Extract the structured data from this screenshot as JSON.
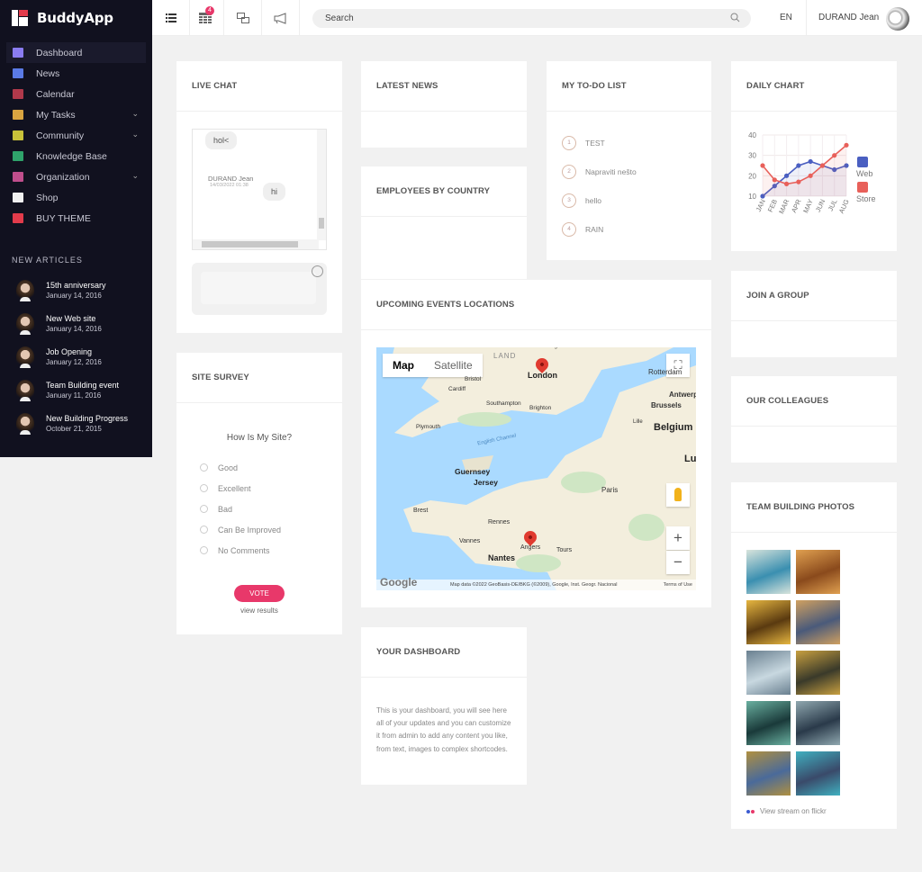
{
  "brand": {
    "name": "BuddyApp"
  },
  "topbar": {
    "icons": [
      {
        "name": "menu-list-icon"
      },
      {
        "name": "calendar-grid-icon",
        "badge": "4"
      },
      {
        "name": "chat-bubbles-icon"
      },
      {
        "name": "megaphone-icon"
      }
    ],
    "search_placeholder": "Search",
    "language": "EN",
    "user_name": "DURAND Jean"
  },
  "sidebar": {
    "items": [
      {
        "label": "Dashboard",
        "icon": "sliders-icon",
        "color": "#8a7cf0",
        "active": true,
        "has_submenu": false
      },
      {
        "label": "News",
        "icon": "document-icon",
        "color": "#5b7be6",
        "active": false,
        "has_submenu": false
      },
      {
        "label": "Calendar",
        "icon": "calendar-icon",
        "color": "#b0394b",
        "active": false,
        "has_submenu": false
      },
      {
        "label": "My Tasks",
        "icon": "tasks-icon",
        "color": "#d9a441",
        "active": false,
        "has_submenu": true
      },
      {
        "label": "Community",
        "icon": "community-icon",
        "color": "#c9c23a",
        "active": false,
        "has_submenu": true
      },
      {
        "label": "Knowledge Base",
        "icon": "lifebuoy-icon",
        "color": "#2fa36b",
        "active": false,
        "has_submenu": false
      },
      {
        "label": "Organization",
        "icon": "grid-icon",
        "color": "#c04e8c",
        "active": false,
        "has_submenu": true
      },
      {
        "label": "Shop",
        "icon": "shopping-bag-icon",
        "color": "#f0f0f0",
        "active": false,
        "has_submenu": false
      },
      {
        "label": "BUY THEME",
        "icon": "cart-icon",
        "color": "#e23b4b",
        "active": false,
        "has_submenu": false
      }
    ],
    "articles_heading": "NEW ARTICLES",
    "articles": [
      {
        "title": "15th anniversary",
        "date": "January 14, 2016"
      },
      {
        "title": "New Web site",
        "date": "January 14, 2016"
      },
      {
        "title": "Job Opening",
        "date": "January 12, 2016"
      },
      {
        "title": "Team Building event",
        "date": "January 11, 2016"
      },
      {
        "title": "New Building Progress",
        "date": "October 21, 2015"
      }
    ]
  },
  "widgets": {
    "live_chat": {
      "title": "LIVE CHAT",
      "messages": [
        {
          "text": "hol<"
        },
        {
          "author": "DURAND Jean",
          "time": "14/03/2022 01:38",
          "text": "hi"
        }
      ]
    },
    "site_survey": {
      "title": "SITE SURVEY",
      "question": "How Is My Site?",
      "options": [
        "Good",
        "Excellent",
        "Bad",
        "Can Be Improved",
        "No Comments"
      ],
      "vote_label": "VOTE",
      "view_results": "view results"
    },
    "latest_news": {
      "title": "LATEST NEWS"
    },
    "employees_by_country": {
      "title": "EMPLOYEES BY COUNTRY"
    },
    "todo": {
      "title": "MY TO-DO LIST",
      "items": [
        {
          "num": "1",
          "text": "TEST"
        },
        {
          "num": "2",
          "text": "Napraviti nešto"
        },
        {
          "num": "3",
          "text": "hello"
        },
        {
          "num": "4",
          "text": "RAIN"
        }
      ]
    },
    "events_map": {
      "title": "UPCOMING EVENTS LOCATIONS",
      "map_type_buttons": [
        "Map",
        "Satellite"
      ],
      "zoom_in": "+",
      "zoom_out": "−",
      "labels": [
        "Cambridge",
        "LAND",
        "London",
        "Bristol",
        "Cardiff",
        "Southampton",
        "Brighton",
        "Plymouth",
        "English Channel",
        "Guernsey",
        "Jersey",
        "Rotterdam",
        "Antwerp",
        "Brussels",
        "Lille",
        "Belgium",
        "Lux",
        "Paris",
        "Brest",
        "Rennes",
        "Vannes",
        "Nantes",
        "Angers",
        "Tours"
      ],
      "pins": [
        "London",
        "Angers"
      ],
      "logo": "Google",
      "attribution": "Map data ©2022 GeoBasis-DE/BKG (©2009), Google, Inst. Geogr. Nacional",
      "terms": "Terms of Use"
    },
    "your_dashboard": {
      "title": "YOUR DASHBOARD",
      "text": "This is your dashboard, you will see here all of your updates and you can customize it from admin to add any content you like, from text, images to complex shortcodes."
    },
    "daily_chart": {
      "title": "DAILY CHART"
    },
    "join_group": {
      "title": "JOIN A GROUP"
    },
    "colleagues": {
      "title": "OUR COLLEAGUES"
    },
    "team_photos": {
      "title": "TEAM BUILDING PHOTOS",
      "photos": [
        {
          "alt": "coastal statue",
          "c1": "#3a8fb0",
          "c2": "#d8e4dc"
        },
        {
          "alt": "cathedral interior",
          "c1": "#8a4a1c",
          "c2": "#e0a050"
        },
        {
          "alt": "golden ceiling",
          "c1": "#5a3a10",
          "c2": "#e6b640"
        },
        {
          "alt": "cathedral columns",
          "c1": "#4a5a7a",
          "c2": "#d0a060"
        },
        {
          "alt": "snowy mountains",
          "c1": "#c8d8e0",
          "c2": "#6a8090"
        },
        {
          "alt": "golden field",
          "c1": "#3a3a2a",
          "c2": "#c8a040"
        },
        {
          "alt": "mountain lake",
          "c1": "#1a3a3a",
          "c2": "#6ab0a0"
        },
        {
          "alt": "waterfall cliff",
          "c1": "#2a3a4a",
          "c2": "#90a8b0"
        },
        {
          "alt": "marsh valley",
          "c1": "#4a6a9a",
          "c2": "#b09040"
        },
        {
          "alt": "turquoise lake",
          "c1": "#3a4a6a",
          "c2": "#40b0c0"
        }
      ],
      "flickr_link": "View stream on flickr"
    }
  },
  "chart_data": {
    "type": "line",
    "title": "DAILY CHART",
    "categories": [
      "JAN",
      "FEB",
      "MAR",
      "APR",
      "MAY",
      "JUN",
      "JUL",
      "AUG"
    ],
    "series": [
      {
        "name": "Web",
        "color": "#4a5fc1",
        "values": [
          10,
          15,
          20,
          25,
          27,
          25,
          23,
          25
        ]
      },
      {
        "name": "Store",
        "color": "#e8605a",
        "values": [
          25,
          18,
          16,
          17,
          20,
          25,
          30,
          35
        ]
      }
    ],
    "yticks": [
      10,
      20,
      30,
      40
    ],
    "ylim": [
      10,
      40
    ],
    "legend": "right",
    "grid": true
  }
}
